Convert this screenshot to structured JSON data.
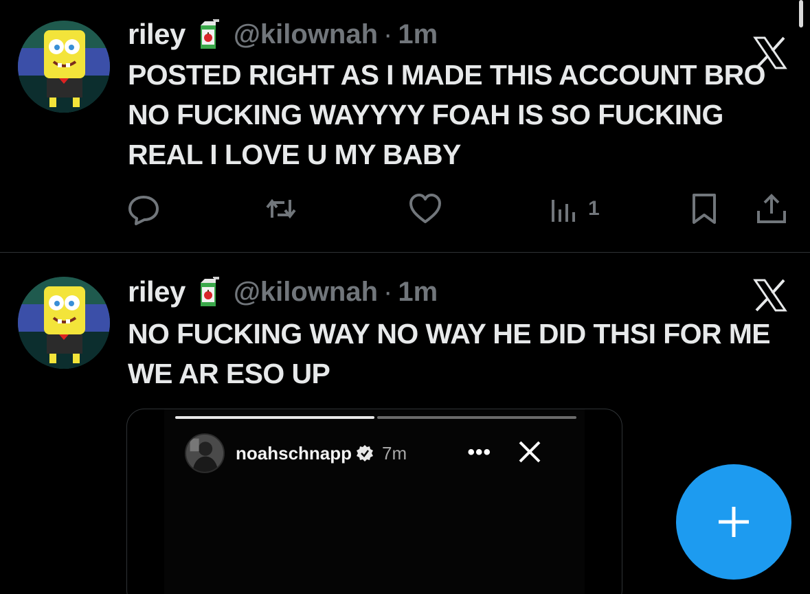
{
  "feed": {
    "tweets": [
      {
        "display_name": "riley",
        "name_emoji_icon": "juice-box-icon",
        "handle": "@kilownah",
        "separator": "·",
        "time": "1m",
        "text": "POSTED RIGHT AS I MADE THIS ACCOUNT BRO NO FUCKING WAYYYY FOAH IS SO FUCKING REAL I LOVE U MY BABY",
        "actions": {
          "reply_icon": "reply-icon",
          "retweet_icon": "retweet-icon",
          "like_icon": "heart-icon",
          "views_icon": "views-icon",
          "views_count": "1",
          "bookmark_icon": "bookmark-icon",
          "share_icon": "share-icon"
        }
      },
      {
        "display_name": "riley",
        "name_emoji_icon": "juice-box-icon",
        "handle": "@kilownah",
        "separator": "·",
        "time": "1m",
        "text": "NO FUCKING WAY NO WAY HE DID THSI FOR ME WE AR ESO UP",
        "media": {
          "type": "instagram-story-screenshot",
          "username": "noahschnapp",
          "verified_icon": "verified-icon",
          "time": "7m",
          "more_label": "•••",
          "close_icon": "close-icon",
          "progress_segments": 2
        }
      }
    ]
  },
  "fab": {
    "icon": "plus-icon"
  },
  "colors": {
    "background": "#000000",
    "text": "#e7e9ea",
    "muted": "#71767b",
    "accent": "#1d9bf0",
    "divider": "#2f3336"
  }
}
